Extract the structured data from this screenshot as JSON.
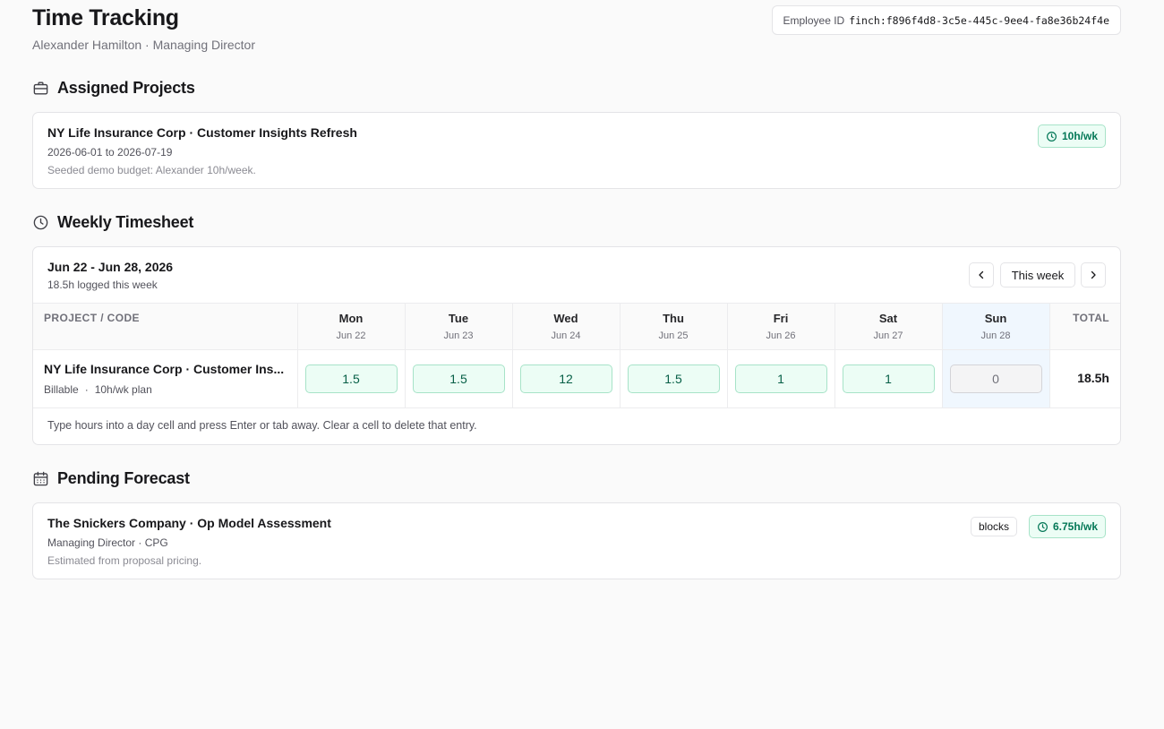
{
  "header": {
    "title": "Time Tracking",
    "subtitle": "Alexander Hamilton · Managing Director",
    "employee_id_label": "Employee ID",
    "employee_id": "finch:f896f4d8-3c5e-445c-9ee4-fa8e36b24f4e"
  },
  "assigned": {
    "heading": "Assigned Projects",
    "icon": "briefcase-icon",
    "project": {
      "title": "NY Life Insurance Corp · Customer Insights Refresh",
      "dates": "2026-06-01 to 2026-07-19",
      "note": "Seeded demo budget: Alexander 10h/week.",
      "budget": "10h/wk"
    }
  },
  "timesheet": {
    "heading": "Weekly Timesheet",
    "icon": "clock-icon",
    "range": "Jun 22 - Jun 28, 2026",
    "logged": "18.5h logged this week",
    "this_week_label": "This week",
    "col_project": "PROJECT / CODE",
    "col_total": "TOTAL",
    "days": [
      {
        "name": "Mon",
        "date": "Jun 22"
      },
      {
        "name": "Tue",
        "date": "Jun 23"
      },
      {
        "name": "Wed",
        "date": "Jun 24"
      },
      {
        "name": "Thu",
        "date": "Jun 25"
      },
      {
        "name": "Fri",
        "date": "Jun 26"
      },
      {
        "name": "Sat",
        "date": "Jun 27"
      },
      {
        "name": "Sun",
        "date": "Jun 28"
      }
    ],
    "row": {
      "title": "NY Life Insurance Corp · Customer Ins...",
      "type": "Billable",
      "sep": "·",
      "plan": "10h/wk plan",
      "hours": [
        "1.5",
        "1.5",
        "12",
        "1.5",
        "1",
        "1",
        "0"
      ],
      "total": "18.5h"
    },
    "hint": "Type hours into a day cell and press Enter or tab away. Clear a cell to delete that entry."
  },
  "forecast": {
    "heading": "Pending Forecast",
    "icon": "calendar-icon",
    "project": {
      "title": "The Snickers Company · Op Model Assessment",
      "role": "Managing Director · CPG",
      "note": "Estimated from proposal pricing.",
      "tag": "blocks",
      "hours": "6.75h/wk"
    }
  },
  "colors": {
    "accent_green": "#047857",
    "green_bg": "#ecfdf5",
    "today_bg": "#f0f7fe"
  }
}
